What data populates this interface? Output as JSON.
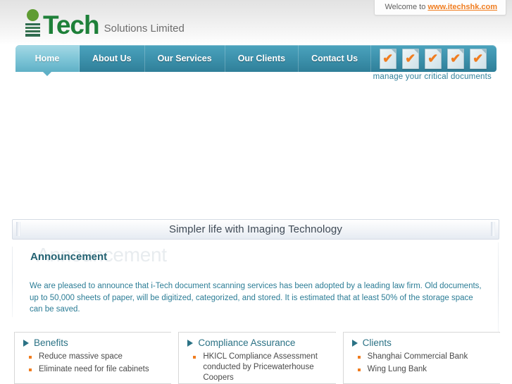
{
  "header": {
    "welcome_prefix": "Welcome to ",
    "welcome_url": "www.itechshk.com",
    "logo_main": "Tech",
    "logo_sub": "Solutions Limited",
    "tagline": "manage your critical documents"
  },
  "nav": {
    "items": [
      {
        "label": "Home",
        "active": true
      },
      {
        "label": "About Us",
        "active": false
      },
      {
        "label": "Our Services",
        "active": false
      },
      {
        "label": "Our Clients",
        "active": false
      },
      {
        "label": "Contact Us",
        "active": false
      }
    ],
    "doc_icon_count": 5,
    "doc_icon_check": "✔"
  },
  "slogan": {
    "text": "Simpler life with Imaging Technology"
  },
  "announcement": {
    "ghost_title": "Announcement",
    "title": "Announcement",
    "body": "We are pleased to announce that i-Tech document scanning services has been adopted by a leading law firm. Old documents, up to 50,000 sheets of paper, will be digitized, categorized, and stored. It is estimated that at least 50% of the storage space can be saved."
  },
  "panels": [
    {
      "title": "Benefits",
      "items": [
        "Reduce massive space",
        "Eliminate need for file cabinets"
      ]
    },
    {
      "title": "Compliance Assurance",
      "items": [
        "HKICL Compliance Assessment conducted by Pricewaterhouse Coopers"
      ]
    },
    {
      "title": "Clients",
      "items": [
        "Shanghai Commercial Bank",
        "Wing Lung Bank"
      ]
    }
  ],
  "colors": {
    "nav_teal": "#2f7f99",
    "accent_orange": "#f07d20",
    "logo_green": "#1e8039",
    "body_text_teal": "#2c7d96"
  }
}
